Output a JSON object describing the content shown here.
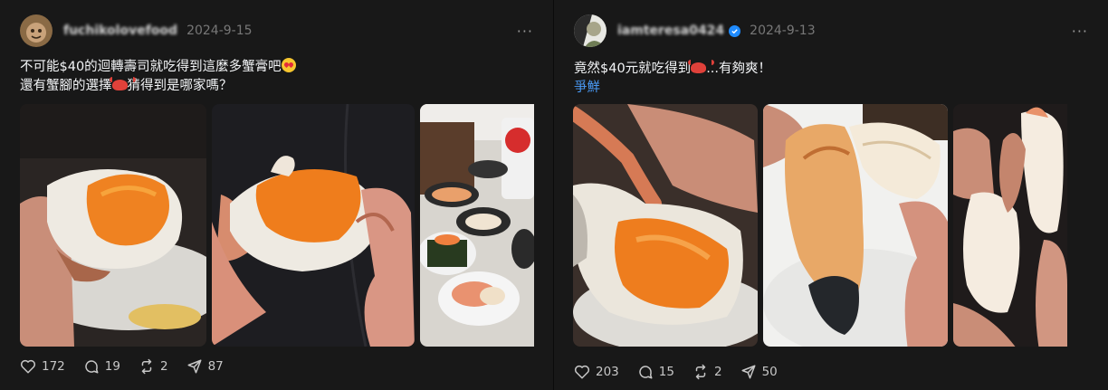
{
  "posts": [
    {
      "username": "fuchikolovefood",
      "date": "2024-9-15",
      "more": "···",
      "line1": "不可能$40的迴轉壽司就吃得到這麼多蟹膏吧",
      "line2a": "還有蟹腳的選擇",
      "line2b": "猜得到是哪家嗎？",
      "likes": "172",
      "comments": "19",
      "reposts": "2",
      "shares": "87"
    },
    {
      "username": "iamteresa0424",
      "verified": true,
      "date": "2024-9-13",
      "more": "···",
      "line1a": "竟然$40元就吃得到",
      "line1b": "...有夠爽！",
      "link": "爭鮮",
      "likes": "203",
      "comments": "15",
      "reposts": "2",
      "shares": "50"
    }
  ],
  "icons": [
    "avatar",
    "more-icon",
    "verified-badge-icon",
    "heart-icon",
    "comment-icon",
    "repost-icon",
    "share-icon",
    "heart-eyes-emoji",
    "crab-emoji"
  ],
  "colors": {
    "background": "#181818",
    "link": "#4a9af5",
    "muted": "#777777"
  }
}
